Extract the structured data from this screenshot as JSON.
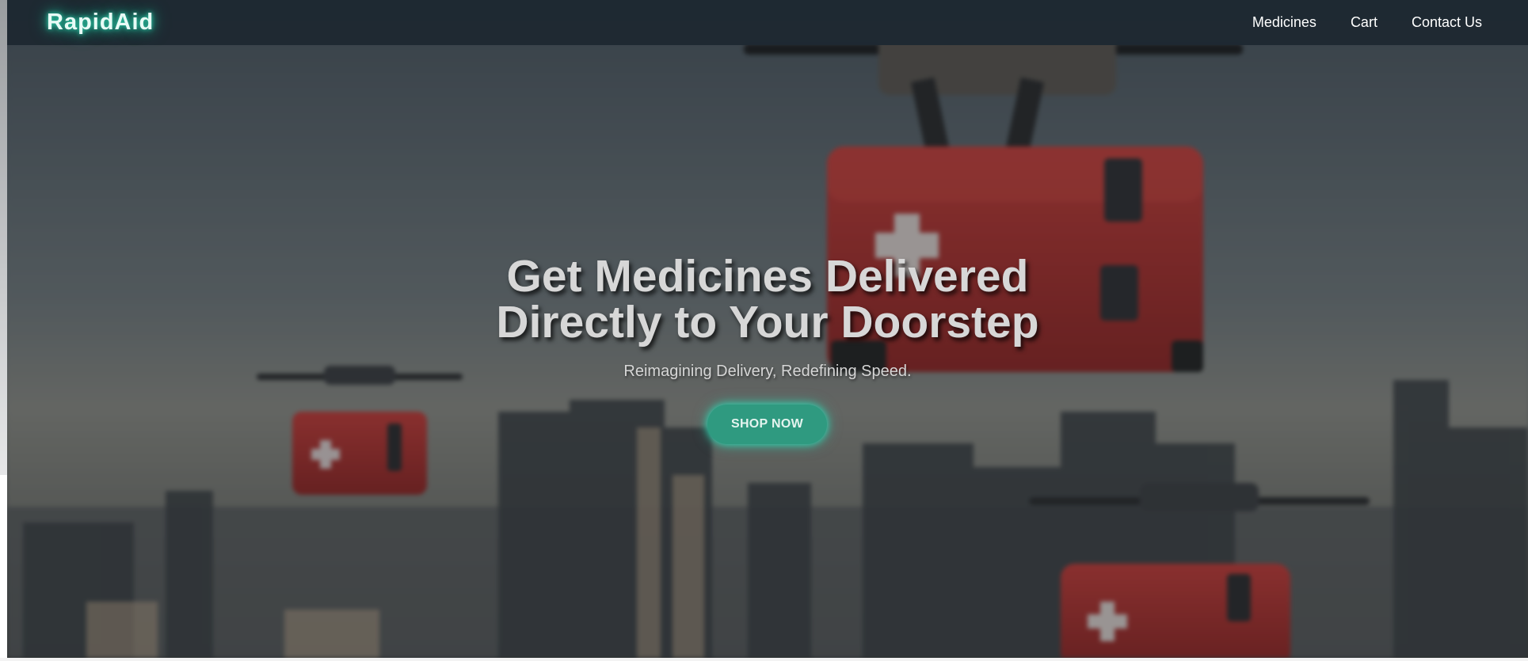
{
  "navbar": {
    "brand": "RapidAid",
    "links": [
      "Medicines",
      "Cart",
      "Contact Us"
    ]
  },
  "hero": {
    "title_line1": "Get Medicines Delivered",
    "title_line2": "Directly to Your Doorstep",
    "subtitle": "Reimagining Delivery, Redefining Speed.",
    "cta_label": "SHOP NOW"
  },
  "colors": {
    "navbar_bg": "#1e2832",
    "brand_glow": "#2fd3b0",
    "cta_bg": "#2f9a80",
    "box_red": "#b3302f"
  },
  "background_image": {
    "subject": "medical-delivery-drones-over-city"
  }
}
